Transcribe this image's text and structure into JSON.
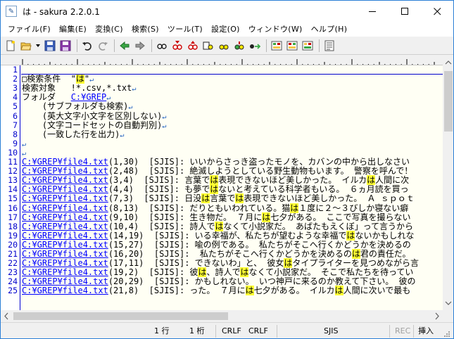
{
  "title": "は - sakura 2.2.0.1",
  "menu": [
    "ファイル(F)",
    "編集(E)",
    "変換(C)",
    "検索(S)",
    "ツール(T)",
    "設定(O)",
    "ウィンドウ(W)",
    "ヘルプ(H)"
  ],
  "toolbar_icons": [
    "new-file-icon",
    "open-folder-icon",
    "dropdown-arrow-icon",
    "save-icon",
    "save-all-icon",
    "undo-icon",
    "redo-icon",
    "jump-prev-icon",
    "jump-next-icon",
    "search-icon",
    "search-next-icon",
    "search-prev-icon",
    "replace-icon",
    "bookmark-icon",
    "grep-icon",
    "tag-jump-icon",
    "tag-back-icon",
    "compare-icon",
    "outline-icon",
    "settings-icon"
  ],
  "editor": {
    "gutter": [
      "1",
      "2",
      "3",
      "4",
      "5",
      "6",
      "7",
      "8",
      "9",
      "10",
      "11",
      "12",
      "13",
      "14",
      "15",
      "16",
      "17",
      "18",
      "19",
      "20",
      "21",
      "22",
      "23",
      "24",
      "25"
    ],
    "lines": [
      [
        {
          "t": ""
        }
      ],
      [
        {
          "t": "□検索条件  \""
        },
        {
          "t": "は",
          "h": true
        },
        {
          "t": "\""
        }
      ],
      [
        {
          "t": "検索対象   !*.csv,*.txt"
        }
      ],
      [
        {
          "t": "フォルダ   "
        },
        {
          "t": "C:¥GREP",
          "p": true
        }
      ],
      [
        {
          "t": "    (サブフォルダも検索)"
        }
      ],
      [
        {
          "t": "    (英大文字小文字を区別しない)"
        }
      ],
      [
        {
          "t": "    (文字コードセットの自動判別)"
        }
      ],
      [
        {
          "t": "    (一致した行を出力)"
        }
      ],
      [
        {
          "t": ""
        }
      ],
      [
        {
          "t": ""
        }
      ],
      [
        {
          "t": "C:¥GREP¥file4.txt",
          "p": true
        },
        {
          "t": "(1,30)  [SJIS]: いいからさっき盗ったモノを、カバンの中から出しなさい"
        }
      ],
      [
        {
          "t": "C:¥GREP¥file4.txt",
          "p": true
        },
        {
          "t": "(2,48)  [SJIS]: 絶滅しようとしている野生動物もいます。 警察を呼んで！"
        }
      ],
      [
        {
          "t": "C:¥GREP¥file4.txt",
          "p": true
        },
        {
          "t": "(3,4)  [SJIS]: 言葉で"
        },
        {
          "t": "は",
          "h": true
        },
        {
          "t": "表現できないほど美しかった。 イルカ"
        },
        {
          "t": "は",
          "h": true
        },
        {
          "t": "人間に次"
        }
      ],
      [
        {
          "t": "C:¥GREP¥file4.txt",
          "p": true
        },
        {
          "t": "(4,4)  [SJIS]: も夢で"
        },
        {
          "t": "は",
          "h": true
        },
        {
          "t": "ないと考えている科学者もいる。 ６ヵ月読を買っ"
        }
      ],
      [
        {
          "t": "C:¥GREP¥file4.txt",
          "p": true
        },
        {
          "t": "(7,3)  [SJIS]: 日没"
        },
        {
          "t": "は",
          "h": true
        },
        {
          "t": "言葉で"
        },
        {
          "t": "は",
          "h": true
        },
        {
          "t": "表現できないほど美しかった。 Ａ ｓｐｏｔ"
        }
      ],
      [
        {
          "t": "C:¥GREP¥file4.txt",
          "p": true
        },
        {
          "t": "(8,13)  [SJIS]: だりともいわれている。猫"
        },
        {
          "t": "は",
          "h": true
        },
        {
          "t": "１度に２～３びしか寝ない癖"
        }
      ],
      [
        {
          "t": "C:¥GREP¥file4.txt",
          "p": true
        },
        {
          "t": "(9,10)  [SJIS]: 生き物だ。 ７月に"
        },
        {
          "t": "は",
          "h": true
        },
        {
          "t": "七夕がある。 ここで写真を撮らない"
        }
      ],
      [
        {
          "t": "C:¥GREP¥file4.txt",
          "p": true
        },
        {
          "t": "(10,4)  [SJIS]: 詩人で"
        },
        {
          "t": "は",
          "h": true
        },
        {
          "t": "なくて小説家だ。 あばたもえくぼ」って言うから"
        }
      ],
      [
        {
          "t": "C:¥GREP¥file4.txt",
          "p": true
        },
        {
          "t": "(14,19)  [SJIS]: いる幸福が、私たちが望むような幸福で"
        },
        {
          "t": "は",
          "h": true
        },
        {
          "t": "ないかもしれな"
        }
      ],
      [
        {
          "t": "C:¥GREP¥file4.txt",
          "p": true
        },
        {
          "t": "(15,27)  [SJIS]: 喩の例である。 私たちがそこへ行くかどうかを決めるの"
        }
      ],
      [
        {
          "t": "C:¥GREP¥file4.txt",
          "p": true
        },
        {
          "t": "(16,20)  [SJIS]:  私たちがそこへ行くかどうかを決めるの"
        },
        {
          "t": "は",
          "h": true
        },
        {
          "t": "君の責任だ。"
        }
      ],
      [
        {
          "t": "C:¥GREP¥file4.txt",
          "p": true
        },
        {
          "t": "(17,11)  [SJIS]: できないわ」と、 彼女"
        },
        {
          "t": "は",
          "h": true
        },
        {
          "t": "タイプライターを見つめながら言"
        }
      ],
      [
        {
          "t": "C:¥GREP¥file4.txt",
          "p": true
        },
        {
          "t": "(19,2)  [SJIS]: 彼"
        },
        {
          "t": "は",
          "h": true
        },
        {
          "t": "、詩人で"
        },
        {
          "t": "は",
          "h": true
        },
        {
          "t": "なくて小説家だ。 そこで私たちを待ってい"
        }
      ],
      [
        {
          "t": "C:¥GREP¥file4.txt",
          "p": true
        },
        {
          "t": "(20,29)  [SJIS]: かもしれない。 いつ神戸に来るのか教えて下さい。 彼の"
        }
      ],
      [
        {
          "t": "C:¥GREP¥file4.txt",
          "p": true
        },
        {
          "t": "(21,8)  [SJIS]: った。 ７月に"
        },
        {
          "t": "は",
          "h": true
        },
        {
          "t": "七夕がある。 イルカ"
        },
        {
          "t": "は",
          "h": true
        },
        {
          "t": "人間に次いで最も"
        }
      ]
    ],
    "eol_lines": [
      1,
      2,
      3,
      4,
      5,
      6,
      7,
      8,
      9
    ]
  },
  "status": {
    "row": "1 行",
    "col": "1 桁",
    "eol1": "CRLF",
    "eol2": "CRLF",
    "encoding": "SJIS",
    "rec": "REC",
    "mode": "挿入"
  },
  "colors": {
    "gutter_text": "#0000cc",
    "path": "#0000ff",
    "highlight": "#ffff33",
    "editor_bg": "#fffff4",
    "accent": "#2b7fd6"
  }
}
